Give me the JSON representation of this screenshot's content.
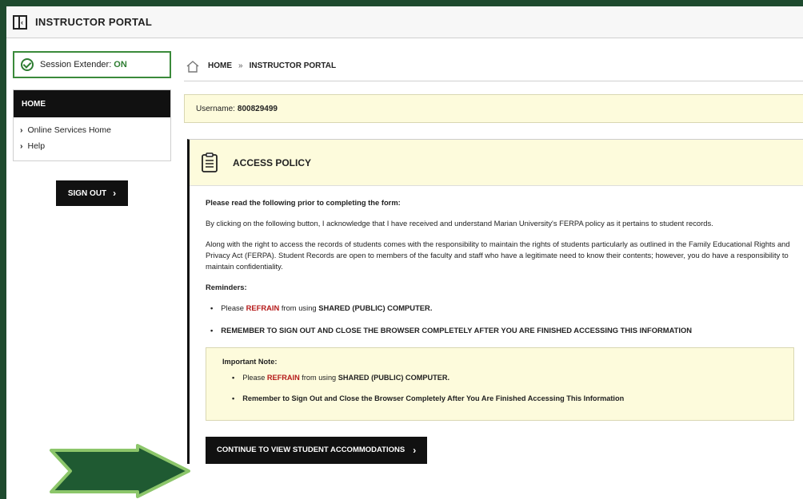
{
  "topbar": {
    "title": "INSTRUCTOR PORTAL"
  },
  "session": {
    "label": "Session Extender:",
    "status": "ON"
  },
  "menu": {
    "header": "HOME",
    "items": [
      {
        "label": "Online Services Home"
      },
      {
        "label": "Help"
      }
    ]
  },
  "signout": {
    "label": "SIGN OUT"
  },
  "breadcrumb": {
    "home": "HOME",
    "separator": "»",
    "current": "INSTRUCTOR PORTAL"
  },
  "user": {
    "label": "Username:",
    "value": "800829499"
  },
  "policy": {
    "title": "ACCESS POLICY",
    "intro": "Please read the following prior to completing the form:",
    "p1": "By clicking on the following button, I acknowledge that I have received and understand Marian University's FERPA policy as it pertains to student records.",
    "p2": "Along with the right to access the records of students comes with the responsibility to maintain the rights of students particularly as outlined in the Family Educational Rights and Privacy Act (FERPA). Student Records are open to members of the faculty and staff who have a legitimate need to know their contents; however, you do have a responsibility to maintain confidentiality.",
    "reminders_label": "Reminders:",
    "reminder1": {
      "pre": "Please ",
      "refrain": "REFRAIN",
      "mid": " from using ",
      "shared": "SHARED (PUBLIC) COMPUTER."
    },
    "reminder2": "REMEMBER TO SIGN OUT AND CLOSE THE BROWSER COMPLETELY AFTER YOU ARE FINISHED ACCESSING THIS INFORMATION"
  },
  "note": {
    "title": "Important Note:",
    "item1": {
      "pre": "Please ",
      "refrain": "REFRAIN",
      "mid": " from using ",
      "shared": "SHARED (PUBLIC) COMPUTER."
    },
    "item2": "Remember to Sign Out and Close the Browser Completely After You Are Finished Accessing This Information"
  },
  "continue": {
    "label": "CONTINUE TO VIEW STUDENT ACCOMMODATIONS"
  },
  "colors": {
    "brand_green": "#1e4a2e",
    "arrow_green": "#1f5a32",
    "arrow_border": "#8cc66a",
    "alert_red": "#b51a1a",
    "note_bg": "#fdfbdc"
  }
}
